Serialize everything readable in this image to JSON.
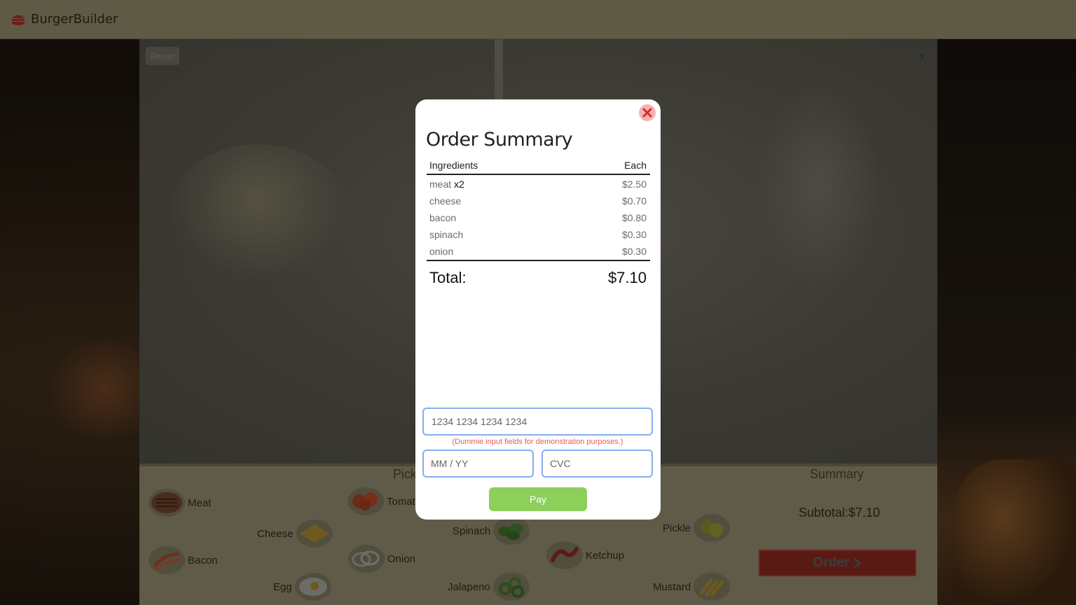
{
  "app": {
    "title": "BurgerBuilder"
  },
  "toolbar": {
    "reset_label": "Reset",
    "close_label": "x"
  },
  "builder": {
    "pick_title": "Pick",
    "summary_title": "Summary",
    "subtotal": "Subtotal:$7.10",
    "order_label": "Order",
    "ingredients": [
      {
        "label": "Meat",
        "icon": "meat-icon"
      },
      {
        "label": "Tomat",
        "icon": "tomato-icon"
      },
      {
        "label": "Cheese",
        "icon": "cheese-icon"
      },
      {
        "label": "Spinach",
        "icon": "spinach-icon"
      },
      {
        "label": "Pickle",
        "icon": "pickle-icon"
      },
      {
        "label": "Bacon",
        "icon": "bacon-icon"
      },
      {
        "label": "Onion",
        "icon": "onion-icon"
      },
      {
        "label": "Ketchup",
        "icon": "ketchup-icon"
      },
      {
        "label": "Egg",
        "icon": "egg-icon"
      },
      {
        "label": "Jalapeno",
        "icon": "jalapeno-icon"
      },
      {
        "label": "Mustard",
        "icon": "mustard-icon"
      }
    ]
  },
  "modal": {
    "title": "Order Summary",
    "col_ingredients": "Ingredients",
    "col_each": "Each",
    "rows": [
      {
        "name": "meat",
        "qty": "x2",
        "price": "$2.50"
      },
      {
        "name": "cheese",
        "qty": "",
        "price": "$0.70"
      },
      {
        "name": "bacon",
        "qty": "",
        "price": "$0.80"
      },
      {
        "name": "spinach",
        "qty": "",
        "price": "$0.30"
      },
      {
        "name": "onion",
        "qty": "",
        "price": "$0.30"
      }
    ],
    "total_label": "Total:",
    "total_value": "$7.10",
    "card_placeholder": "1234 1234 1234 1234",
    "note": "(Dummie input fields for demonstration purposes.)",
    "expiry_placeholder": "MM / YY",
    "cvc_placeholder": "CVC",
    "pay_label": "Pay"
  },
  "colors": {
    "pay_green": "#8ccf5a",
    "order_red": "#5a1a14",
    "input_blue": "#86aef0",
    "note_red": "#e85a5a"
  }
}
